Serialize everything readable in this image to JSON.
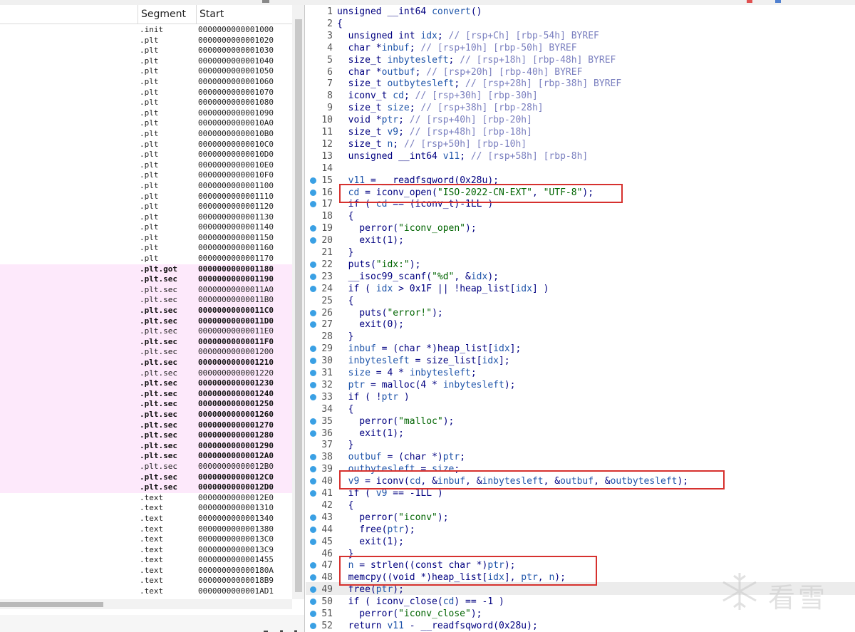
{
  "segments_header": {
    "segment": "Segment",
    "start": "Start"
  },
  "segments": [
    {
      "seg": ".init",
      "start": "0000000000001000",
      "bold": false,
      "sel": false
    },
    {
      "seg": ".plt",
      "start": "0000000000001020",
      "bold": false,
      "sel": false
    },
    {
      "seg": ".plt",
      "start": "0000000000001030",
      "bold": false,
      "sel": false
    },
    {
      "seg": ".plt",
      "start": "0000000000001040",
      "bold": false,
      "sel": false
    },
    {
      "seg": ".plt",
      "start": "0000000000001050",
      "bold": false,
      "sel": false
    },
    {
      "seg": ".plt",
      "start": "0000000000001060",
      "bold": false,
      "sel": false
    },
    {
      "seg": ".plt",
      "start": "0000000000001070",
      "bold": false,
      "sel": false
    },
    {
      "seg": ".plt",
      "start": "0000000000001080",
      "bold": false,
      "sel": false
    },
    {
      "seg": ".plt",
      "start": "0000000000001090",
      "bold": false,
      "sel": false
    },
    {
      "seg": ".plt",
      "start": "00000000000010A0",
      "bold": false,
      "sel": false
    },
    {
      "seg": ".plt",
      "start": "00000000000010B0",
      "bold": false,
      "sel": false
    },
    {
      "seg": ".plt",
      "start": "00000000000010C0",
      "bold": false,
      "sel": false
    },
    {
      "seg": ".plt",
      "start": "00000000000010D0",
      "bold": false,
      "sel": false
    },
    {
      "seg": ".plt",
      "start": "00000000000010E0",
      "bold": false,
      "sel": false
    },
    {
      "seg": ".plt",
      "start": "00000000000010F0",
      "bold": false,
      "sel": false
    },
    {
      "seg": ".plt",
      "start": "0000000000001100",
      "bold": false,
      "sel": false
    },
    {
      "seg": ".plt",
      "start": "0000000000001110",
      "bold": false,
      "sel": false
    },
    {
      "seg": ".plt",
      "start": "0000000000001120",
      "bold": false,
      "sel": false
    },
    {
      "seg": ".plt",
      "start": "0000000000001130",
      "bold": false,
      "sel": false
    },
    {
      "seg": ".plt",
      "start": "0000000000001140",
      "bold": false,
      "sel": false
    },
    {
      "seg": ".plt",
      "start": "0000000000001150",
      "bold": false,
      "sel": false
    },
    {
      "seg": ".plt",
      "start": "0000000000001160",
      "bold": false,
      "sel": false
    },
    {
      "seg": ".plt",
      "start": "0000000000001170",
      "bold": false,
      "sel": false
    },
    {
      "seg": ".plt.got",
      "start": "0000000000001180",
      "bold": true,
      "sel": true
    },
    {
      "seg": ".plt.sec",
      "start": "0000000000001190",
      "bold": true,
      "sel": true
    },
    {
      "seg": ".plt.sec",
      "start": "00000000000011A0",
      "bold": false,
      "sel": true
    },
    {
      "seg": ".plt.sec",
      "start": "00000000000011B0",
      "bold": false,
      "sel": true
    },
    {
      "seg": ".plt.sec",
      "start": "00000000000011C0",
      "bold": true,
      "sel": true
    },
    {
      "seg": ".plt.sec",
      "start": "00000000000011D0",
      "bold": true,
      "sel": true
    },
    {
      "seg": ".plt.sec",
      "start": "00000000000011E0",
      "bold": false,
      "sel": true
    },
    {
      "seg": ".plt.sec",
      "start": "00000000000011F0",
      "bold": true,
      "sel": true
    },
    {
      "seg": ".plt.sec",
      "start": "0000000000001200",
      "bold": false,
      "sel": true
    },
    {
      "seg": ".plt.sec",
      "start": "0000000000001210",
      "bold": true,
      "sel": true
    },
    {
      "seg": ".plt.sec",
      "start": "0000000000001220",
      "bold": false,
      "sel": true
    },
    {
      "seg": ".plt.sec",
      "start": "0000000000001230",
      "bold": true,
      "sel": true
    },
    {
      "seg": ".plt.sec",
      "start": "0000000000001240",
      "bold": true,
      "sel": true
    },
    {
      "seg": ".plt.sec",
      "start": "0000000000001250",
      "bold": true,
      "sel": true
    },
    {
      "seg": ".plt.sec",
      "start": "0000000000001260",
      "bold": true,
      "sel": true
    },
    {
      "seg": ".plt.sec",
      "start": "0000000000001270",
      "bold": true,
      "sel": true
    },
    {
      "seg": ".plt.sec",
      "start": "0000000000001280",
      "bold": true,
      "sel": true
    },
    {
      "seg": ".plt.sec",
      "start": "0000000000001290",
      "bold": true,
      "sel": true
    },
    {
      "seg": ".plt.sec",
      "start": "00000000000012A0",
      "bold": true,
      "sel": true
    },
    {
      "seg": ".plt.sec",
      "start": "00000000000012B0",
      "bold": false,
      "sel": true
    },
    {
      "seg": ".plt.sec",
      "start": "00000000000012C0",
      "bold": true,
      "sel": true
    },
    {
      "seg": ".plt.sec",
      "start": "00000000000012D0",
      "bold": true,
      "sel": true
    },
    {
      "seg": ".text",
      "start": "00000000000012E0",
      "bold": false,
      "sel": false
    },
    {
      "seg": ".text",
      "start": "0000000000001310",
      "bold": false,
      "sel": false
    },
    {
      "seg": ".text",
      "start": "0000000000001340",
      "bold": false,
      "sel": false
    },
    {
      "seg": ".text",
      "start": "0000000000001380",
      "bold": false,
      "sel": false
    },
    {
      "seg": ".text",
      "start": "00000000000013C0",
      "bold": false,
      "sel": false
    },
    {
      "seg": ".text",
      "start": "00000000000013C9",
      "bold": false,
      "sel": false
    },
    {
      "seg": ".text",
      "start": "0000000000001455",
      "bold": false,
      "sel": false
    },
    {
      "seg": ".text",
      "start": "000000000000180A",
      "bold": false,
      "sel": false
    },
    {
      "seg": ".text",
      "start": "00000000000018B9",
      "bold": false,
      "sel": false
    },
    {
      "seg": ".text",
      "start": "0000000000001AD1",
      "bold": false,
      "sel": false
    }
  ],
  "code_lines": [
    {
      "n": "1",
      "bp": false,
      "t": [
        [
          "k",
          "unsigned __int64 "
        ],
        [
          "v",
          "convert"
        ],
        [
          "k",
          "()"
        ]
      ],
      "top": true
    },
    {
      "n": "2",
      "bp": false,
      "t": [
        [
          "k",
          "{"
        ]
      ],
      "top": true
    },
    {
      "n": "3",
      "bp": false,
      "t": [
        [
          "k",
          "  unsigned int "
        ],
        [
          "v",
          "idx"
        ],
        [
          "k",
          "; "
        ],
        [
          "c",
          "// [rsp+Ch] [rbp-54h] BYREF"
        ]
      ]
    },
    {
      "n": "4",
      "bp": false,
      "t": [
        [
          "k",
          "  char *"
        ],
        [
          "v",
          "inbuf"
        ],
        [
          "k",
          "; "
        ],
        [
          "c",
          "// [rsp+10h] [rbp-50h] BYREF"
        ]
      ]
    },
    {
      "n": "5",
      "bp": false,
      "t": [
        [
          "k",
          "  size_t "
        ],
        [
          "v",
          "inbytesleft"
        ],
        [
          "k",
          "; "
        ],
        [
          "c",
          "// [rsp+18h] [rbp-48h] BYREF"
        ]
      ]
    },
    {
      "n": "6",
      "bp": false,
      "t": [
        [
          "k",
          "  char *"
        ],
        [
          "v",
          "outbuf"
        ],
        [
          "k",
          "; "
        ],
        [
          "c",
          "// [rsp+20h] [rbp-40h] BYREF"
        ]
      ]
    },
    {
      "n": "7",
      "bp": false,
      "t": [
        [
          "k",
          "  size_t "
        ],
        [
          "v",
          "outbytesleft"
        ],
        [
          "k",
          "; "
        ],
        [
          "c",
          "// [rsp+28h] [rbp-38h] BYREF"
        ]
      ]
    },
    {
      "n": "8",
      "bp": false,
      "t": [
        [
          "k",
          "  iconv_t "
        ],
        [
          "v",
          "cd"
        ],
        [
          "k",
          "; "
        ],
        [
          "c",
          "// [rsp+30h] [rbp-30h]"
        ]
      ]
    },
    {
      "n": "9",
      "bp": false,
      "t": [
        [
          "k",
          "  size_t "
        ],
        [
          "v",
          "size"
        ],
        [
          "k",
          "; "
        ],
        [
          "c",
          "// [rsp+38h] [rbp-28h]"
        ]
      ]
    },
    {
      "n": "10",
      "bp": false,
      "t": [
        [
          "k",
          "  void *"
        ],
        [
          "v",
          "ptr"
        ],
        [
          "k",
          "; "
        ],
        [
          "c",
          "// [rsp+40h] [rbp-20h]"
        ]
      ]
    },
    {
      "n": "11",
      "bp": false,
      "t": [
        [
          "k",
          "  size_t "
        ],
        [
          "v",
          "v9"
        ],
        [
          "k",
          "; "
        ],
        [
          "c",
          "// [rsp+48h] [rbp-18h]"
        ]
      ]
    },
    {
      "n": "12",
      "bp": false,
      "t": [
        [
          "k",
          "  size_t "
        ],
        [
          "v",
          "n"
        ],
        [
          "k",
          "; "
        ],
        [
          "c",
          "// [rsp+50h] [rbp-10h]"
        ]
      ]
    },
    {
      "n": "13",
      "bp": false,
      "t": [
        [
          "k",
          "  unsigned __int64 "
        ],
        [
          "v",
          "v11"
        ],
        [
          "k",
          "; "
        ],
        [
          "c",
          "// [rsp+58h] [rbp-8h]"
        ]
      ]
    },
    {
      "n": "14",
      "bp": false,
      "t": [
        [
          "k",
          ""
        ]
      ]
    },
    {
      "n": "15",
      "bp": true,
      "t": [
        [
          "k",
          "  "
        ],
        [
          "v",
          "v11"
        ],
        [
          "k",
          " = __readfsqword(0x28u);"
        ]
      ]
    },
    {
      "n": "16",
      "bp": true,
      "t": [
        [
          "k",
          "  "
        ],
        [
          "v",
          "cd"
        ],
        [
          "k",
          " = iconv_open("
        ],
        [
          "s",
          "\"ISO-2022-CN-EXT\""
        ],
        [
          "k",
          ", "
        ],
        [
          "s",
          "\"UTF-8\""
        ],
        [
          "k",
          ");"
        ]
      ]
    },
    {
      "n": "17",
      "bp": true,
      "t": [
        [
          "k",
          "  if ( "
        ],
        [
          "v",
          "cd"
        ],
        [
          "k",
          " == (iconv_t)-1LL )"
        ]
      ]
    },
    {
      "n": "18",
      "bp": false,
      "t": [
        [
          "k",
          "  {"
        ]
      ]
    },
    {
      "n": "19",
      "bp": true,
      "t": [
        [
          "k",
          "    perror("
        ],
        [
          "s",
          "\"iconv_open\""
        ],
        [
          "k",
          ");"
        ]
      ]
    },
    {
      "n": "20",
      "bp": true,
      "t": [
        [
          "k",
          "    exit(1);"
        ]
      ]
    },
    {
      "n": "21",
      "bp": false,
      "t": [
        [
          "k",
          "  }"
        ]
      ]
    },
    {
      "n": "22",
      "bp": true,
      "t": [
        [
          "k",
          "  puts("
        ],
        [
          "s",
          "\"idx:\""
        ],
        [
          "k",
          ");"
        ]
      ]
    },
    {
      "n": "23",
      "bp": true,
      "t": [
        [
          "k",
          "  __isoc99_scanf("
        ],
        [
          "s",
          "\"%d\""
        ],
        [
          "k",
          ", &"
        ],
        [
          "v",
          "idx"
        ],
        [
          "k",
          ");"
        ]
      ]
    },
    {
      "n": "24",
      "bp": true,
      "t": [
        [
          "k",
          "  if ( "
        ],
        [
          "v",
          "idx"
        ],
        [
          "k",
          " > 0x1F || !heap_list["
        ],
        [
          "v",
          "idx"
        ],
        [
          "k",
          "] )"
        ]
      ]
    },
    {
      "n": "25",
      "bp": false,
      "t": [
        [
          "k",
          "  {"
        ]
      ]
    },
    {
      "n": "26",
      "bp": true,
      "t": [
        [
          "k",
          "    puts("
        ],
        [
          "s",
          "\"error!\""
        ],
        [
          "k",
          ");"
        ]
      ]
    },
    {
      "n": "27",
      "bp": true,
      "t": [
        [
          "k",
          "    exit(0);"
        ]
      ]
    },
    {
      "n": "28",
      "bp": false,
      "t": [
        [
          "k",
          "  }"
        ]
      ]
    },
    {
      "n": "29",
      "bp": true,
      "t": [
        [
          "k",
          "  "
        ],
        [
          "v",
          "inbuf"
        ],
        [
          "k",
          " = (char *)heap_list["
        ],
        [
          "v",
          "idx"
        ],
        [
          "k",
          "];"
        ]
      ]
    },
    {
      "n": "30",
      "bp": true,
      "t": [
        [
          "k",
          "  "
        ],
        [
          "v",
          "inbytesleft"
        ],
        [
          "k",
          " = size_list["
        ],
        [
          "v",
          "idx"
        ],
        [
          "k",
          "];"
        ]
      ]
    },
    {
      "n": "31",
      "bp": true,
      "t": [
        [
          "k",
          "  "
        ],
        [
          "v",
          "size"
        ],
        [
          "k",
          " = 4 * "
        ],
        [
          "v",
          "inbytesleft"
        ],
        [
          "k",
          ";"
        ]
      ]
    },
    {
      "n": "32",
      "bp": true,
      "t": [
        [
          "k",
          "  "
        ],
        [
          "v",
          "ptr"
        ],
        [
          "k",
          " = malloc(4 * "
        ],
        [
          "v",
          "inbytesleft"
        ],
        [
          "k",
          ");"
        ]
      ]
    },
    {
      "n": "33",
      "bp": true,
      "t": [
        [
          "k",
          "  if ( !"
        ],
        [
          "v",
          "ptr"
        ],
        [
          "k",
          " )"
        ]
      ]
    },
    {
      "n": "34",
      "bp": false,
      "t": [
        [
          "k",
          "  {"
        ]
      ]
    },
    {
      "n": "35",
      "bp": true,
      "t": [
        [
          "k",
          "    perror("
        ],
        [
          "s",
          "\"malloc\""
        ],
        [
          "k",
          ");"
        ]
      ]
    },
    {
      "n": "36",
      "bp": true,
      "t": [
        [
          "k",
          "    exit(1);"
        ]
      ]
    },
    {
      "n": "37",
      "bp": false,
      "t": [
        [
          "k",
          "  }"
        ]
      ]
    },
    {
      "n": "38",
      "bp": true,
      "t": [
        [
          "k",
          "  "
        ],
        [
          "v",
          "outbuf"
        ],
        [
          "k",
          " = (char *)"
        ],
        [
          "v",
          "ptr"
        ],
        [
          "k",
          ";"
        ]
      ]
    },
    {
      "n": "39",
      "bp": true,
      "t": [
        [
          "k",
          "  "
        ],
        [
          "v",
          "outbytesleft"
        ],
        [
          "k",
          " = "
        ],
        [
          "v",
          "size"
        ],
        [
          "k",
          ";"
        ]
      ]
    },
    {
      "n": "40",
      "bp": true,
      "t": [
        [
          "k",
          "  "
        ],
        [
          "v",
          "v9"
        ],
        [
          "k",
          " = iconv("
        ],
        [
          "v",
          "cd"
        ],
        [
          "k",
          ", &"
        ],
        [
          "v",
          "inbuf"
        ],
        [
          "k",
          ", &"
        ],
        [
          "v",
          "inbytesleft"
        ],
        [
          "k",
          ", &"
        ],
        [
          "v",
          "outbuf"
        ],
        [
          "k",
          ", &"
        ],
        [
          "v",
          "outbytesleft"
        ],
        [
          "k",
          ");"
        ]
      ]
    },
    {
      "n": "41",
      "bp": true,
      "t": [
        [
          "k",
          "  if ( "
        ],
        [
          "v",
          "v9"
        ],
        [
          "k",
          " == -1LL )"
        ]
      ]
    },
    {
      "n": "42",
      "bp": false,
      "t": [
        [
          "k",
          "  {"
        ]
      ]
    },
    {
      "n": "43",
      "bp": true,
      "t": [
        [
          "k",
          "    perror("
        ],
        [
          "s",
          "\"iconv\""
        ],
        [
          "k",
          ");"
        ]
      ]
    },
    {
      "n": "44",
      "bp": true,
      "t": [
        [
          "k",
          "    free("
        ],
        [
          "v",
          "ptr"
        ],
        [
          "k",
          ");"
        ]
      ]
    },
    {
      "n": "45",
      "bp": true,
      "t": [
        [
          "k",
          "    exit(1);"
        ]
      ]
    },
    {
      "n": "46",
      "bp": false,
      "t": [
        [
          "k",
          "  }"
        ]
      ]
    },
    {
      "n": "47",
      "bp": true,
      "t": [
        [
          "k",
          "  "
        ],
        [
          "v",
          "n"
        ],
        [
          "k",
          " = strlen((const char *)"
        ],
        [
          "v",
          "ptr"
        ],
        [
          "k",
          ");"
        ]
      ]
    },
    {
      "n": "48",
      "bp": true,
      "t": [
        [
          "k",
          "  memcpy((void *)heap_list["
        ],
        [
          "v",
          "idx"
        ],
        [
          "k",
          "], "
        ],
        [
          "v",
          "ptr"
        ],
        [
          "k",
          ", "
        ],
        [
          "v",
          "n"
        ],
        [
          "k",
          ");"
        ]
      ]
    },
    {
      "n": "49",
      "bp": true,
      "t": [
        [
          "k",
          "  free("
        ],
        [
          "v",
          "ptr"
        ],
        [
          "k",
          ");"
        ]
      ]
    },
    {
      "n": "50",
      "bp": true,
      "t": [
        [
          "k",
          "  if ( iconv_close("
        ],
        [
          "v",
          "cd"
        ],
        [
          "k",
          ") == -1 )"
        ]
      ]
    },
    {
      "n": "51",
      "bp": true,
      "t": [
        [
          "k",
          "    perror("
        ],
        [
          "s",
          "\"iconv_close\""
        ],
        [
          "k",
          ");"
        ]
      ]
    },
    {
      "n": "52",
      "bp": true,
      "t": [
        [
          "k",
          "  return "
        ],
        [
          "v",
          "v11"
        ],
        [
          "k",
          " - __readfsqword(0x28u);"
        ]
      ]
    }
  ],
  "watermark": {
    "text": "看雪"
  },
  "colors": {
    "highlight_box": "#d6312e",
    "breakpoint_dot": "#3aa0e4",
    "selection": "#fde9fb"
  }
}
